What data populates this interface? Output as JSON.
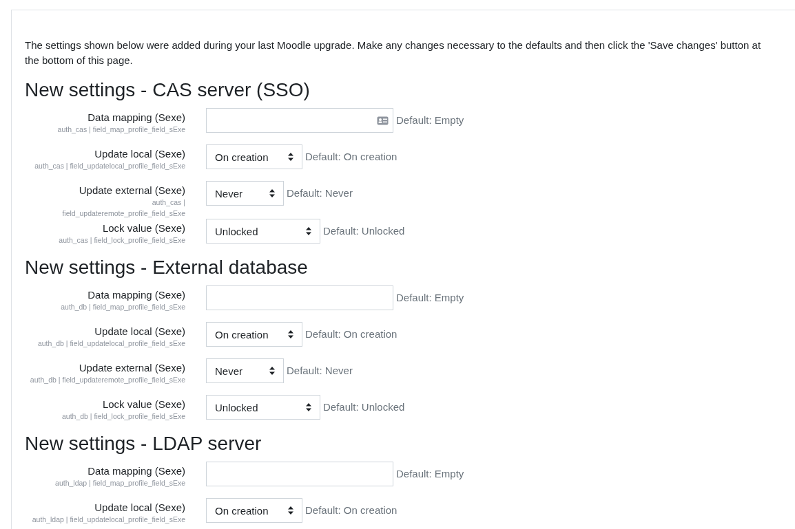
{
  "intro": "The settings shown below were added during your last Moodle upgrade. Make any changes necessary to the defaults and then click the 'Save changes' button at the bottom of this page.",
  "sections": [
    {
      "heading": "New settings - CAS server (SSO)",
      "settings": [
        {
          "label": "Data mapping (Sexe)",
          "key": "auth_cas | field_map_profile_field_sExe",
          "kind": "text",
          "autofill_icon": true,
          "default": "Default: Empty"
        },
        {
          "label": "Update local (Sexe)",
          "key": "auth_cas | field_updatelocal_profile_field_sExe",
          "kind": "select",
          "value": "On creation",
          "default": "Default: On creation"
        },
        {
          "label": "Update external (Sexe)",
          "key": "auth_cas | field_updateremote_profile_field_sExe",
          "kind": "select",
          "value": "Never",
          "default": "Default: Never"
        },
        {
          "label": "Lock value (Sexe)",
          "key": "auth_cas | field_lock_profile_field_sExe",
          "kind": "select",
          "value": "Unlocked",
          "default": "Default: Unlocked"
        }
      ]
    },
    {
      "heading": "New settings - External database",
      "settings": [
        {
          "label": "Data mapping (Sexe)",
          "key": "auth_db | field_map_profile_field_sExe",
          "kind": "text",
          "autofill_icon": false,
          "default": "Default: Empty"
        },
        {
          "label": "Update local (Sexe)",
          "key": "auth_db | field_updatelocal_profile_field_sExe",
          "kind": "select",
          "value": "On creation",
          "default": "Default: On creation"
        },
        {
          "label": "Update external (Sexe)",
          "key": "auth_db | field_updateremote_profile_field_sExe",
          "kind": "select",
          "value": "Never",
          "default": "Default: Never"
        },
        {
          "label": "Lock value (Sexe)",
          "key": "auth_db | field_lock_profile_field_sExe",
          "kind": "select",
          "value": "Unlocked",
          "default": "Default: Unlocked"
        }
      ]
    },
    {
      "heading": "New settings - LDAP server",
      "settings": [
        {
          "label": "Data mapping (Sexe)",
          "key": "auth_ldap | field_map_profile_field_sExe",
          "kind": "text",
          "autofill_icon": false,
          "default": "Default: Empty"
        },
        {
          "label": "Update local (Sexe)",
          "key": "auth_ldap | field_updatelocal_profile_field_sExe",
          "kind": "select",
          "value": "On creation",
          "default": "Default: On creation"
        }
      ]
    }
  ]
}
